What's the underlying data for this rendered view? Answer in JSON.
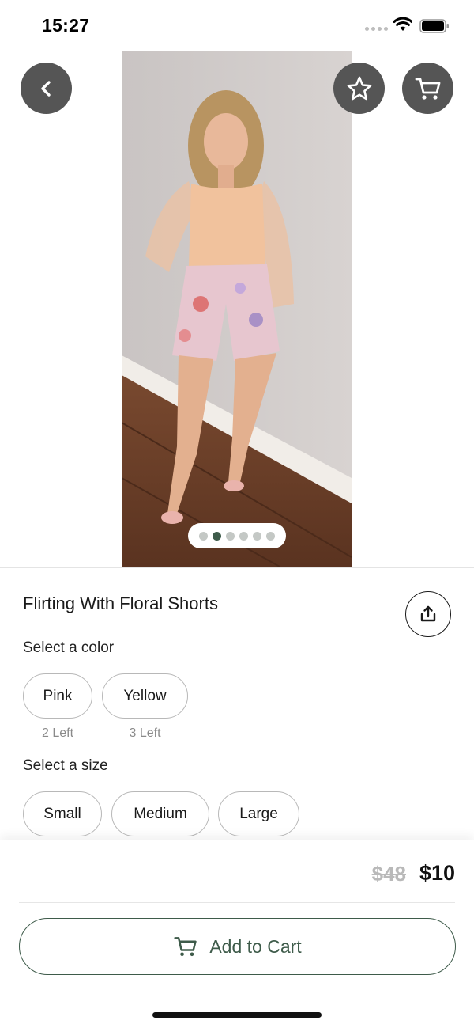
{
  "status_bar": {
    "time": "15:27"
  },
  "header": {
    "back_icon": "chevron-left-icon",
    "favorite_icon": "star-icon",
    "cart_icon": "cart-icon"
  },
  "gallery": {
    "page_count": 6,
    "active_index": 1
  },
  "product": {
    "title": "Flirting With Floral Shorts",
    "share_icon": "share-icon"
  },
  "color": {
    "label": "Select a color",
    "options": [
      {
        "name": "Pink",
        "stock": "2 Left"
      },
      {
        "name": "Yellow",
        "stock": "3 Left"
      }
    ]
  },
  "size": {
    "label": "Select a size",
    "options": [
      "Small",
      "Medium",
      "Large"
    ]
  },
  "price": {
    "original": "$48",
    "sale": "$10"
  },
  "cta": {
    "label": "Add to Cart"
  },
  "colors": {
    "accent": "#3e5b4a",
    "button_bg": "#555555"
  }
}
